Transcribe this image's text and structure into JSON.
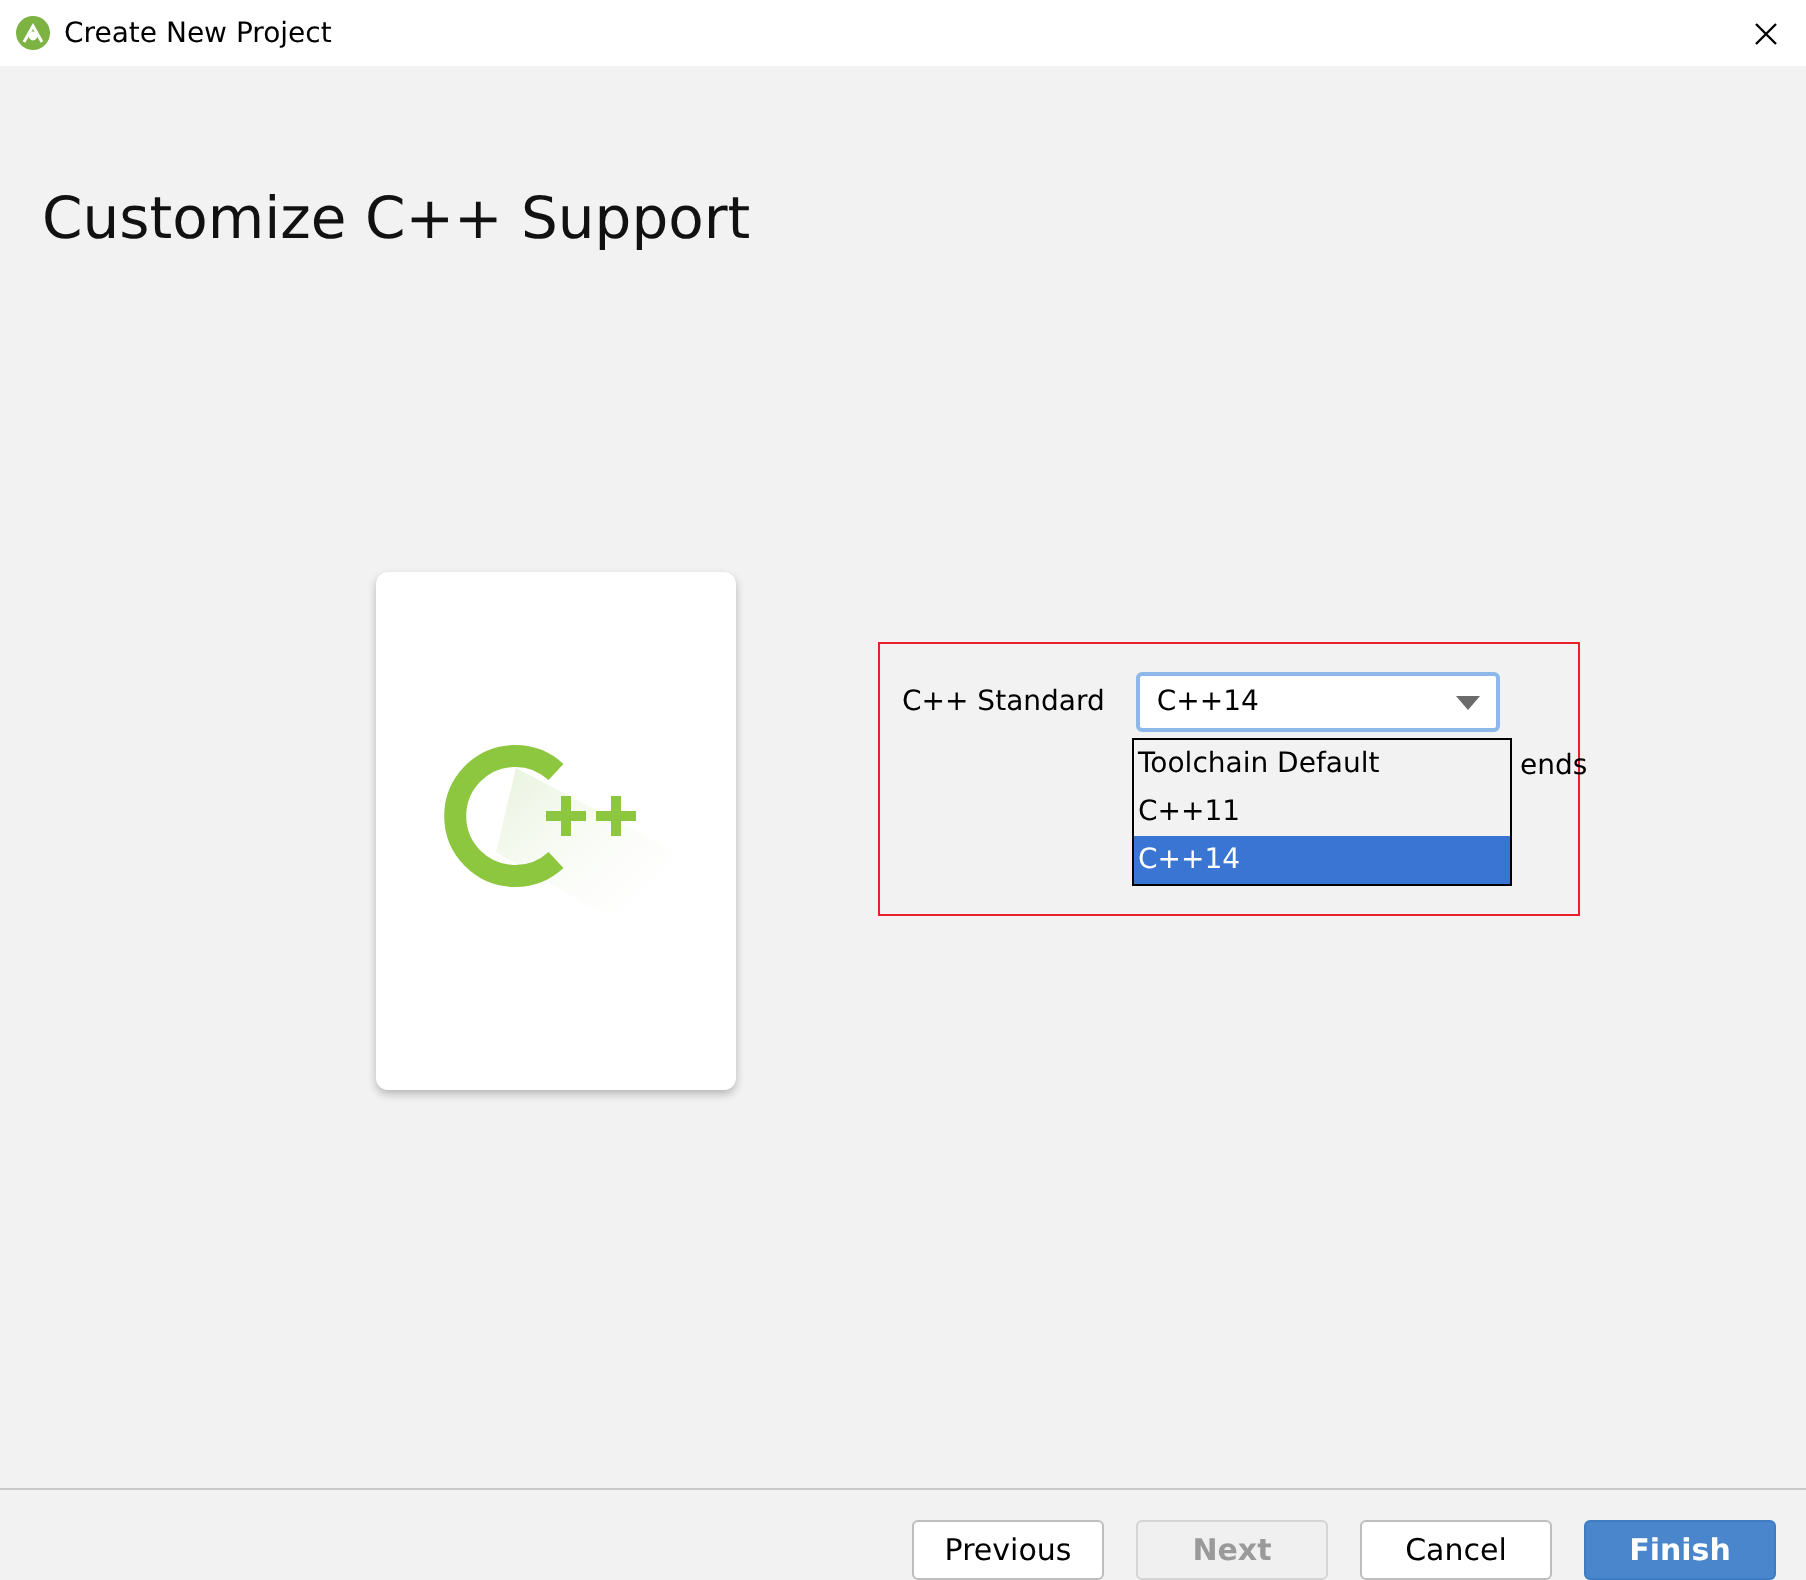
{
  "window": {
    "title": "Create New Project"
  },
  "heading": "Customize C++ Support",
  "cpp_standard": {
    "label": "C++ Standard",
    "value": "C++14",
    "expanded": true,
    "options": [
      {
        "label": "Toolchain Default",
        "selected": false
      },
      {
        "label": "C++11",
        "selected": false
      },
      {
        "label": "C++14",
        "selected": true
      }
    ]
  },
  "hidden_option_text": "ends",
  "buttons": [
    {
      "label": "Previous",
      "kind": "normal",
      "disabled": false
    },
    {
      "label": "Next",
      "kind": "normal",
      "disabled": true
    },
    {
      "label": "Cancel",
      "kind": "normal",
      "disabled": false
    },
    {
      "label": "Finish",
      "kind": "primary",
      "disabled": false
    }
  ]
}
